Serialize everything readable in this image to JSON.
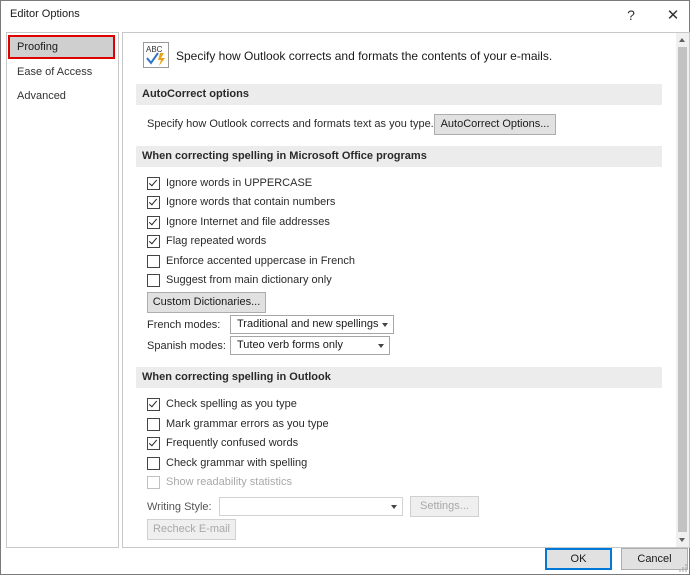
{
  "window": {
    "title": "Editor Options",
    "help_glyph": "?",
    "close_glyph": "✕"
  },
  "nav": {
    "items": [
      {
        "label": "Proofing",
        "selected": true
      },
      {
        "label": "Ease of Access",
        "selected": false
      },
      {
        "label": "Advanced",
        "selected": false
      }
    ]
  },
  "header": {
    "icon": "abc-spellcheck-icon",
    "icon_text": "ABC",
    "text": "Specify how Outlook corrects and formats the contents of your e-mails."
  },
  "autocorrect": {
    "section_title": "AutoCorrect options",
    "description": "Specify how Outlook corrects and formats text as you type.",
    "button_label": "AutoCorrect Options..."
  },
  "office_spelling": {
    "section_title": "When correcting spelling in Microsoft Office programs",
    "options": [
      {
        "label": "Ignore words in UPPERCASE",
        "checked": true
      },
      {
        "label": "Ignore words that contain numbers",
        "checked": true
      },
      {
        "label": "Ignore Internet and file addresses",
        "checked": true
      },
      {
        "label": "Flag repeated words",
        "checked": true
      },
      {
        "label": "Enforce accented uppercase in French",
        "checked": false
      },
      {
        "label": "Suggest from main dictionary only",
        "checked": false
      }
    ],
    "custom_dictionaries_label": "Custom Dictionaries...",
    "french_modes_label": "French modes:",
    "french_modes_value": "Traditional and new spellings",
    "spanish_modes_label": "Spanish modes:",
    "spanish_modes_value": "Tuteo verb forms only"
  },
  "outlook_spelling": {
    "section_title": "When correcting spelling in Outlook",
    "options": [
      {
        "label": "Check spelling as you type",
        "checked": true,
        "disabled": false
      },
      {
        "label": "Mark grammar errors as you type",
        "checked": false,
        "disabled": false
      },
      {
        "label": "Frequently confused words",
        "checked": true,
        "disabled": false
      },
      {
        "label": "Check grammar with spelling",
        "checked": false,
        "disabled": false
      },
      {
        "label": "Show readability statistics",
        "checked": false,
        "disabled": true
      }
    ],
    "writing_style_label": "Writing Style:",
    "writing_style_value": "",
    "settings_label": "Settings...",
    "recheck_label": "Recheck E-mail"
  },
  "footer": {
    "ok_label": "OK",
    "cancel_label": "Cancel"
  },
  "colors": {
    "selection_outline": "#e00000",
    "primary_button_border": "#0078d7",
    "section_bg": "#ececec"
  }
}
